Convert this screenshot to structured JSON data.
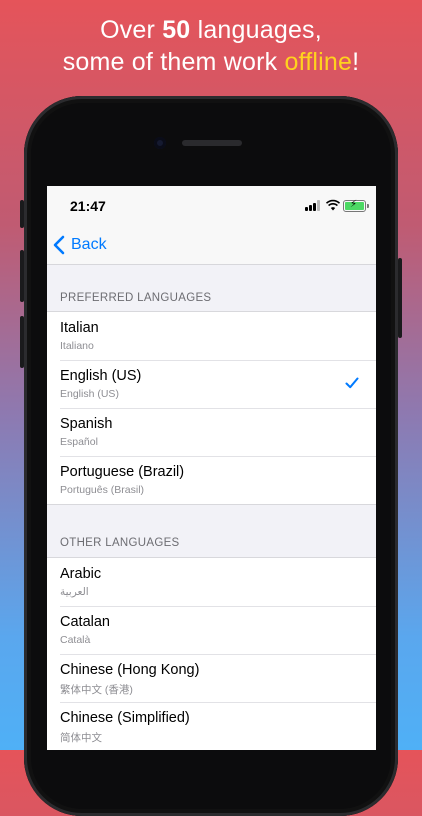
{
  "promo": {
    "line1_prefix": "Over ",
    "line1_number": "50",
    "line1_suffix": " languages,",
    "line2_prefix": "some of them work ",
    "line2_accent": "offline",
    "line2_suffix": "!",
    "accent_color": "#ffd21e"
  },
  "status_bar": {
    "time": "21:47",
    "battery_icon": "battery-charging-icon",
    "wifi_icon": "wifi-icon",
    "signal_icon": "cellular-signal-icon"
  },
  "nav": {
    "back_label": "Back",
    "tint_color": "#007aff"
  },
  "preferred": {
    "header": "PREFERRED LANGUAGES",
    "items": [
      {
        "name": "Italian",
        "native": "Italiano",
        "selected": false
      },
      {
        "name": "English (US)",
        "native": "English (US)",
        "selected": true
      },
      {
        "name": "Spanish",
        "native": "Español",
        "selected": false
      },
      {
        "name": "Portuguese (Brazil)",
        "native": "Português (Brasil)",
        "selected": false
      }
    ]
  },
  "other": {
    "header": "OTHER LANGUAGES",
    "items": [
      {
        "name": "Arabic",
        "native": "العربية"
      },
      {
        "name": "Catalan",
        "native": "Català"
      },
      {
        "name": "Chinese (Hong Kong)",
        "native": "繁体中文 (香港)"
      },
      {
        "name": "Chinese (Simplified)",
        "native": "简体中文"
      }
    ]
  }
}
